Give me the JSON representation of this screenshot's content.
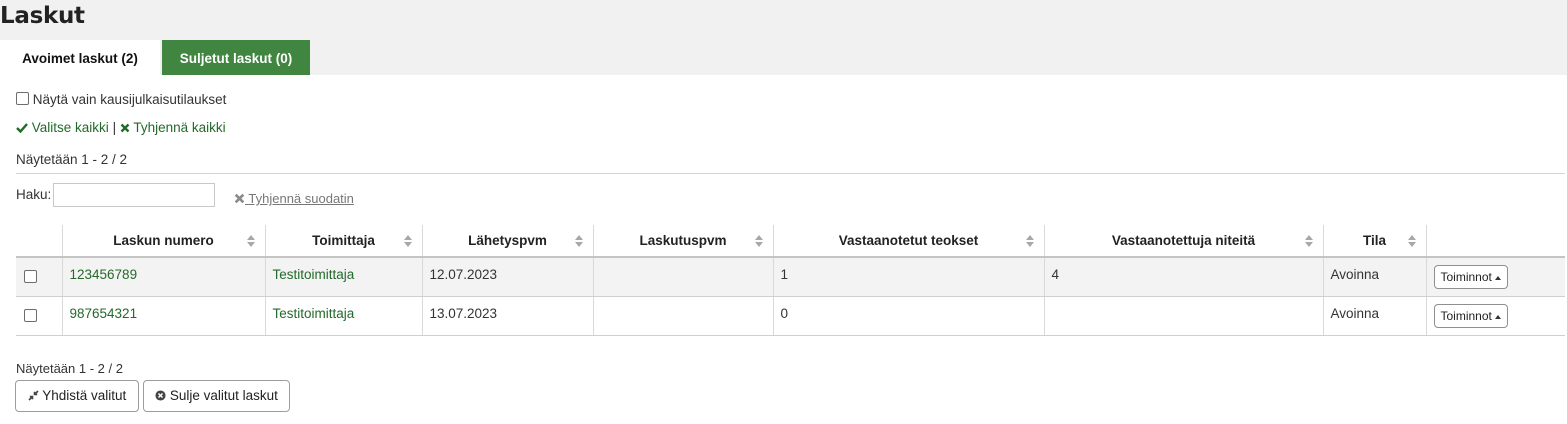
{
  "page": {
    "title": "Laskut"
  },
  "tabs": [
    {
      "label": "Avoimet laskut (2)",
      "active": true
    },
    {
      "label": "Suljetut laskut (0)",
      "active": false
    }
  ],
  "filter": {
    "seasonal_label": "Näytä vain kausijulkaisutilaukset"
  },
  "selection": {
    "select_all": "Valitse kaikki",
    "separator": "|",
    "clear_all": "Tyhjennä kaikki"
  },
  "info_top": "Näytetään 1 - 2 / 2",
  "search": {
    "label": "Haku:",
    "value": "",
    "clear_filter": "Tyhjennä suodatin"
  },
  "table": {
    "headers": [
      "Laskun numero",
      "Toimittaja",
      "Lähetyspvm",
      "Laskutuspvm",
      "Vastaanotetut teokset",
      "Vastaanotettuja niteitä",
      "Tila"
    ],
    "rows": [
      {
        "number": "123456789",
        "vendor": "Testitoimittaja",
        "shipping_date": "12.07.2023",
        "invoice_date": "",
        "received_titles": "1",
        "received_items": "4",
        "status": "Avoinna",
        "actions": "Toiminnot"
      },
      {
        "number": "987654321",
        "vendor": "Testitoimittaja",
        "shipping_date": "13.07.2023",
        "invoice_date": "",
        "received_titles": "0",
        "received_items": "",
        "status": "Avoinna",
        "actions": "Toiminnot"
      }
    ]
  },
  "info_bottom": "Näytetään 1 - 2 / 2",
  "buttons": {
    "merge": "Yhdistä valitut",
    "close": "Sulje valitut laskut"
  },
  "colors": {
    "accent_green": "#408540",
    "link_green": "#23692a",
    "header_bg": "#f1f1f1"
  },
  "icons": {
    "check": "check-icon",
    "cross": "times-icon",
    "merge": "compress-icon",
    "close": "times-circle-icon"
  }
}
